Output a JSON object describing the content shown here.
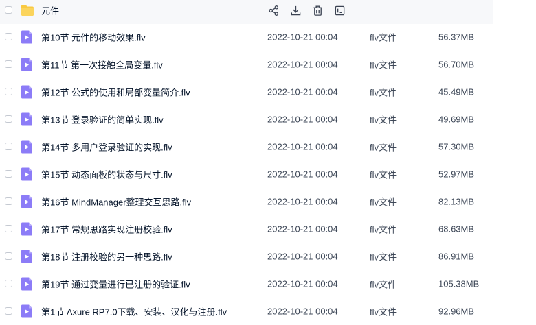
{
  "folder": {
    "name": "元件",
    "actions": [
      "share-icon",
      "download-icon",
      "delete-icon",
      "more-icon"
    ]
  },
  "files": [
    {
      "name": "第10节  元件的移动效果.flv",
      "date": "2022-10-21 00:04",
      "type": "flv文件",
      "size": "56.37MB"
    },
    {
      "name": "第11节  第一次接触全局变量.flv",
      "date": "2022-10-21 00:04",
      "type": "flv文件",
      "size": "56.70MB"
    },
    {
      "name": "第12节  公式的使用和局部变量简介.flv",
      "date": "2022-10-21 00:04",
      "type": "flv文件",
      "size": "45.49MB"
    },
    {
      "name": "第13节  登录验证的简单实现.flv",
      "date": "2022-10-21 00:04",
      "type": "flv文件",
      "size": "49.69MB"
    },
    {
      "name": "第14节  多用户登录验证的实现.flv",
      "date": "2022-10-21 00:04",
      "type": "flv文件",
      "size": "57.30MB"
    },
    {
      "name": "第15节  动态面板的状态与尺寸.flv",
      "date": "2022-10-21 00:04",
      "type": "flv文件",
      "size": "52.97MB"
    },
    {
      "name": "第16节  MindManager整理交互思路.flv",
      "date": "2022-10-21 00:04",
      "type": "flv文件",
      "size": "82.13MB"
    },
    {
      "name": "第17节  常规思路实现注册校验.flv",
      "date": "2022-10-21 00:04",
      "type": "flv文件",
      "size": "68.63MB"
    },
    {
      "name": "第18节  注册校验的另一种思路.flv",
      "date": "2022-10-21 00:04",
      "type": "flv文件",
      "size": "86.91MB"
    },
    {
      "name": "第19节  通过变量进行已注册的验证.flv",
      "date": "2022-10-21 00:04",
      "type": "flv文件",
      "size": "105.38MB"
    },
    {
      "name": "第1节  Axure RP7.0下载、安装、汉化与注册.flv",
      "date": "2022-10-21 00:04",
      "type": "flv文件",
      "size": "92.96MB"
    }
  ],
  "colors": {
    "folder": "#f9c941",
    "video": "#8c7cf7",
    "row_hover": "#f7f8fa"
  }
}
